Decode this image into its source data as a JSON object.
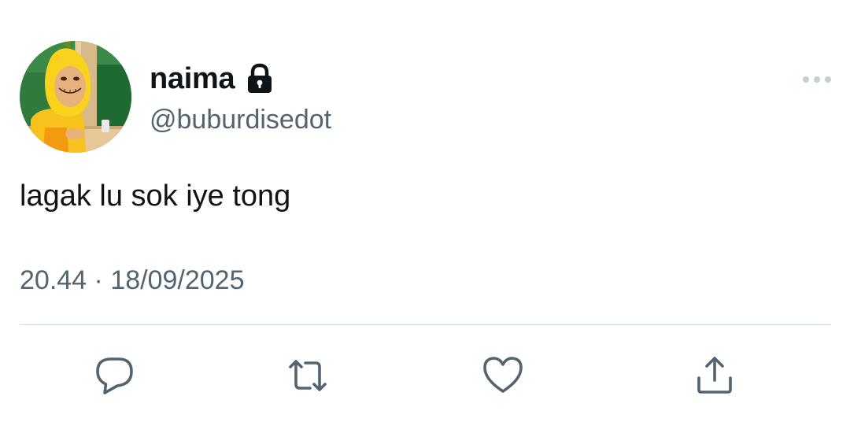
{
  "user": {
    "display_name": "naima",
    "handle": "@buburdisedot",
    "protected_icon": "lock-icon",
    "avatar_icon": "avatar"
  },
  "tweet": {
    "text": "lagak lu sok iye tong",
    "time": "20.44",
    "separator": "·",
    "date": "18/09/2025"
  },
  "actions": {
    "reply_icon": "reply-icon",
    "retweet_icon": "retweet-icon",
    "like_icon": "heart-icon",
    "share_icon": "share-icon"
  },
  "menu": {
    "more_icon": "more-icon"
  },
  "colors": {
    "text_primary": "#0f1419",
    "text_secondary": "#536471",
    "divider": "#cfd9de",
    "icon": "#536471"
  }
}
